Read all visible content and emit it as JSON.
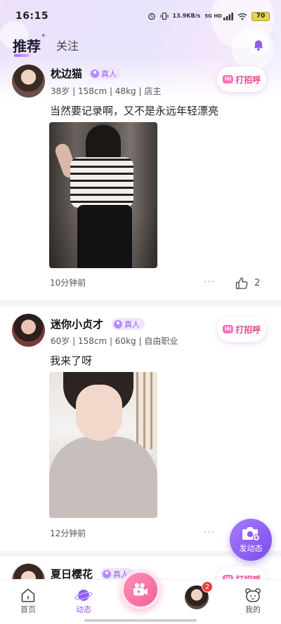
{
  "status_bar": {
    "time": "16:15",
    "speed_value": "13.9",
    "speed_unit": "KB/s",
    "network": "5G HD",
    "battery": "70"
  },
  "header": {
    "tab_recommend": "推荐",
    "tab_follow": "关注"
  },
  "posts": [
    {
      "name": "枕边猫",
      "badge": "真人",
      "meta": "38岁 | 158cm | 48kg | 店主",
      "greet": "打招呼",
      "greet_hi": "Hi",
      "text": "当然要记录啊，又不是永远年轻漂亮",
      "time": "10分钟前",
      "more": "···",
      "likes": "2"
    },
    {
      "name": "迷你小贞才",
      "badge": "真人",
      "meta": "60岁 | 158cm | 60kg | 自由职业",
      "greet": "打招呼",
      "greet_hi": "Hi",
      "text": "我来了呀",
      "time": "12分钟前",
      "more": "···"
    },
    {
      "name": "夏日樱花",
      "badge": "真人",
      "greet": "打招呼",
      "greet_hi": "Hi"
    }
  ],
  "fab": {
    "label": "发动态"
  },
  "nav": {
    "home": "首页",
    "moments": "动态",
    "messages_badge": "2",
    "mine": "我的"
  },
  "colors": {
    "accent": "#8f5cf3",
    "greet_text": "#e8488a",
    "badge_bg": "#efe6fd"
  }
}
